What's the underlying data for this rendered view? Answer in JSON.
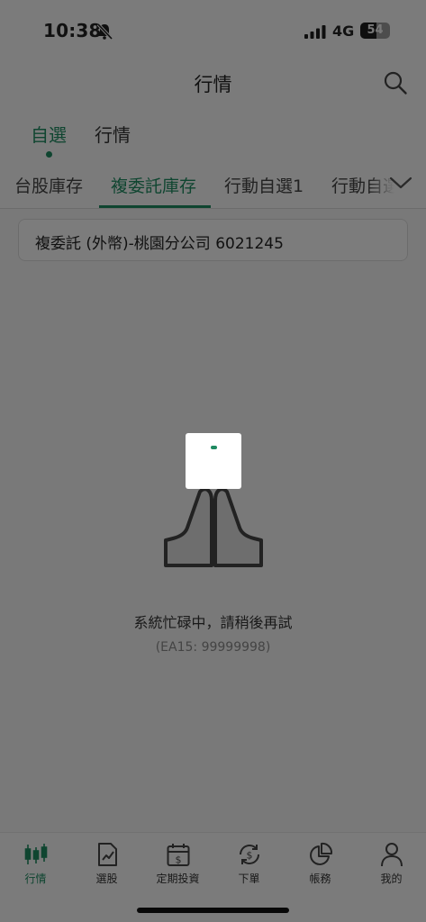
{
  "status_bar": {
    "time": "10:38",
    "network": "4G",
    "battery": "54",
    "battery_level": 0.54
  },
  "header": {
    "title": "行情"
  },
  "top_tabs": [
    {
      "label": "自選",
      "active": true
    },
    {
      "label": "行情",
      "active": false
    }
  ],
  "sub_tabs": [
    {
      "label": "台股庫存",
      "active": false
    },
    {
      "label": "複委託庫存",
      "active": true
    },
    {
      "label": "行動自選1",
      "active": false
    },
    {
      "label": "行動自選",
      "active": false
    }
  ],
  "account": {
    "label": "複委託 (外幣)-桃園分公司 6021245"
  },
  "error": {
    "message": "系統忙碌中，請稍後再試",
    "code": "(EA15: 99999998)"
  },
  "bottom_nav": [
    {
      "label": "行情",
      "icon": "candlestick-icon",
      "active": true
    },
    {
      "label": "選股",
      "icon": "stock-pick-icon",
      "active": false
    },
    {
      "label": "定期投資",
      "icon": "calendar-dollar-icon",
      "active": false
    },
    {
      "label": "下單",
      "icon": "order-icon",
      "active": false
    },
    {
      "label": "帳務",
      "icon": "pie-chart-icon",
      "active": false
    },
    {
      "label": "我的",
      "icon": "profile-icon",
      "active": false
    }
  ],
  "colors": {
    "accent": "#1f8a61",
    "overlay": "rgba(0,0,0,0.5)"
  }
}
